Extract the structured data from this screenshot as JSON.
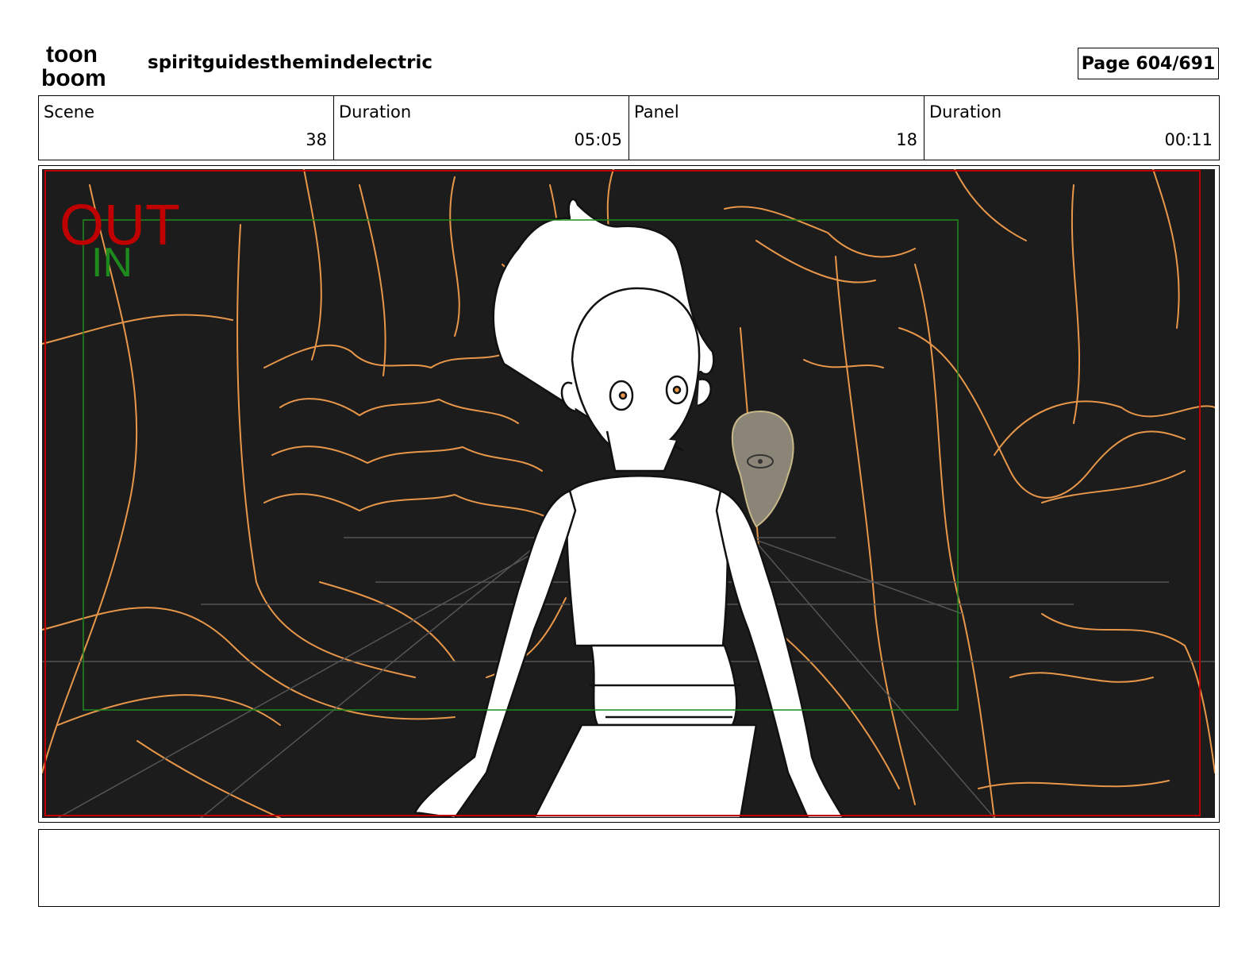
{
  "header": {
    "logo": {
      "line1": "toon",
      "line2": "boom"
    },
    "project_title": "spiritguidesthemindelectric",
    "page_label": "Page 604/691"
  },
  "info": {
    "scene_label": "Scene",
    "scene_value": "38",
    "scene_duration_label": "Duration",
    "scene_duration_value": "05:05",
    "panel_label": "Panel",
    "panel_value": "18",
    "panel_duration_label": "Duration",
    "panel_duration_value": "00:11"
  },
  "panel": {
    "out_label": "OUT",
    "in_label": "IN",
    "colors": {
      "background": "#1c1c1c",
      "sketch_lines": "#e8974a",
      "out_frame": "#c00000",
      "in_frame": "#1e8a1e"
    }
  },
  "notes": {
    "text": ""
  }
}
